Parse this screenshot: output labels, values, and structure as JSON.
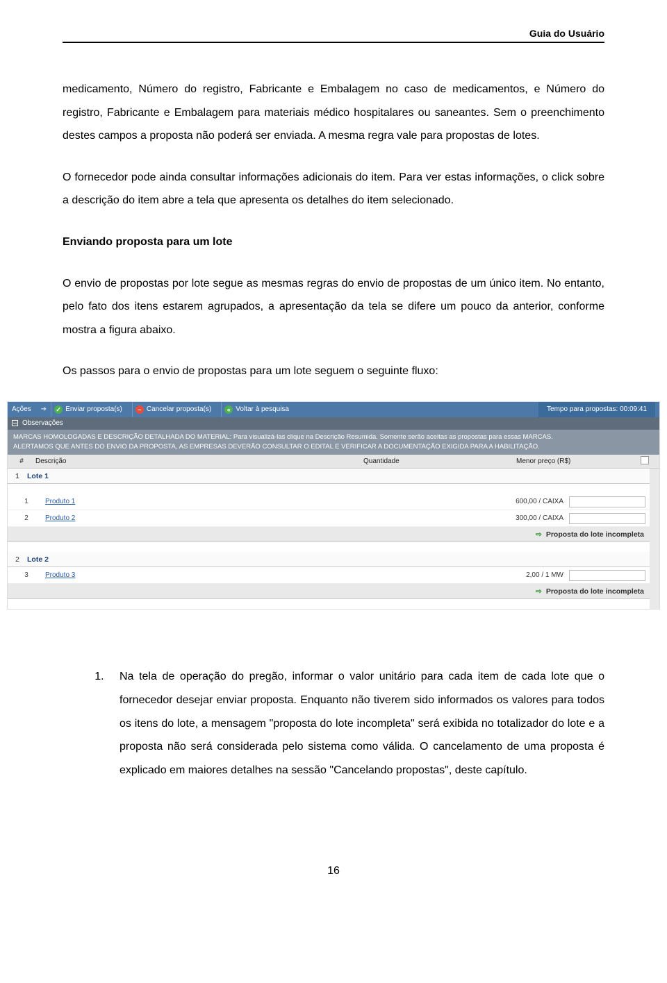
{
  "header": {
    "title": "Guia do Usuário"
  },
  "content": {
    "p1": "medicamento, Número do registro, Fabricante e Embalagem no caso de medicamentos, e Número do registro, Fabricante e Embalagem para materiais médico hospitalares ou saneantes. Sem o preenchimento destes campos a proposta não poderá ser enviada. A mesma regra vale para propostas de lotes.",
    "p2": "O fornecedor pode ainda consultar informações adicionais do item. Para ver estas informações, o click sobre a descrição do item abre a tela que apresenta os detalhes do item selecionado.",
    "heading": "Enviando proposta para um lote",
    "p3": "O envio de propostas por lote segue as mesmas regras do envio de propostas de um único item. No entanto, pelo fato dos itens estarem agrupados, a apresentação da tela se difere um pouco da anterior, conforme mostra a figura abaixo.",
    "p4": "Os passos para o envio de propostas para um lote seguem o seguinte fluxo:",
    "step1": "Na tela de operação do pregão, informar o valor unitário para cada item de cada lote que o fornecedor desejar enviar proposta. Enquanto não tiverem sido informados os valores para todos os itens do lote, a mensagem \"proposta do lote incompleta\" será exibida no totalizador do lote e a proposta não será considerada pelo sistema como válida. O cancelamento de uma proposta é explicado em maiores detalhes na sessão \"Cancelando propostas\", deste capítulo."
  },
  "screenshot": {
    "toolbar": {
      "acoes": "Ações",
      "enviar": "Enviar proposta(s)",
      "cancelar": "Cancelar proposta(s)",
      "voltar": "Voltar à pesquisa",
      "tempo_label": "Tempo para propostas:  00:09:41"
    },
    "obs_label": "Observações",
    "notice_line1": "MARCAS HOMOLOGADAS E DESCRIÇÃO DETALHADA DO MATERIAL: Para visualizá-las clique na Descrição Resumida. Somente serão aceitas as propostas para essas MARCAS.",
    "notice_line2": "ALERTAMOS QUE ANTES DO ENVIO DA PROPOSTA, AS EMPRESAS DEVERÃO CONSULTAR O EDITAL E VERIFICAR A DOCUMENTAÇÃO EXIGIDA PARA A HABILITAÇÃO.",
    "columns": {
      "num": "#",
      "desc": "Descrição",
      "qtd": "Quantidade",
      "preco": "Menor preço (R$)"
    },
    "lote1": {
      "num": "1",
      "name": "Lote 1"
    },
    "lote2": {
      "num": "2",
      "name": "Lote 2"
    },
    "prod1": {
      "num": "1",
      "name": "Produto 1",
      "qtd": "600,00 / CAIXA"
    },
    "prod2": {
      "num": "2",
      "name": "Produto 2",
      "qtd": "300,00 / CAIXA"
    },
    "prod3": {
      "num": "3",
      "name": "Produto 3",
      "qtd": "2,00 / 1 MW"
    },
    "incompleta": "Proposta do lote incompleta"
  },
  "page_number": "16"
}
